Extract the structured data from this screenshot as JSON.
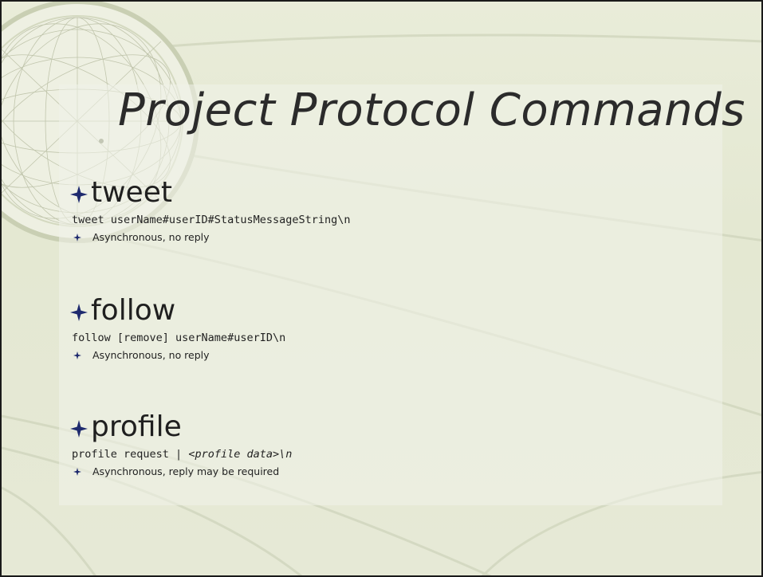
{
  "slide": {
    "title": "Project Protocol Commands",
    "sections": [
      {
        "heading": "tweet",
        "code": "tweet userName#userID#StatusMessageString\\n",
        "bullet": "Asynchronous, no reply"
      },
      {
        "heading": "follow",
        "code": "follow [remove] userName#userID\\n",
        "bullet": "Asynchronous, no reply"
      },
      {
        "heading": "profile",
        "code_prefix": "profile request | ",
        "code_italic": "<profile  data>\\n",
        "bullet": "Asynchronous, reply may be required"
      }
    ]
  },
  "icons": {
    "bullet_large": "four-point-star-icon",
    "bullet_small": "four-point-star-icon"
  },
  "colors": {
    "background": "#e6e9d6",
    "bullet": "#1e2a6e",
    "text": "#222222"
  }
}
